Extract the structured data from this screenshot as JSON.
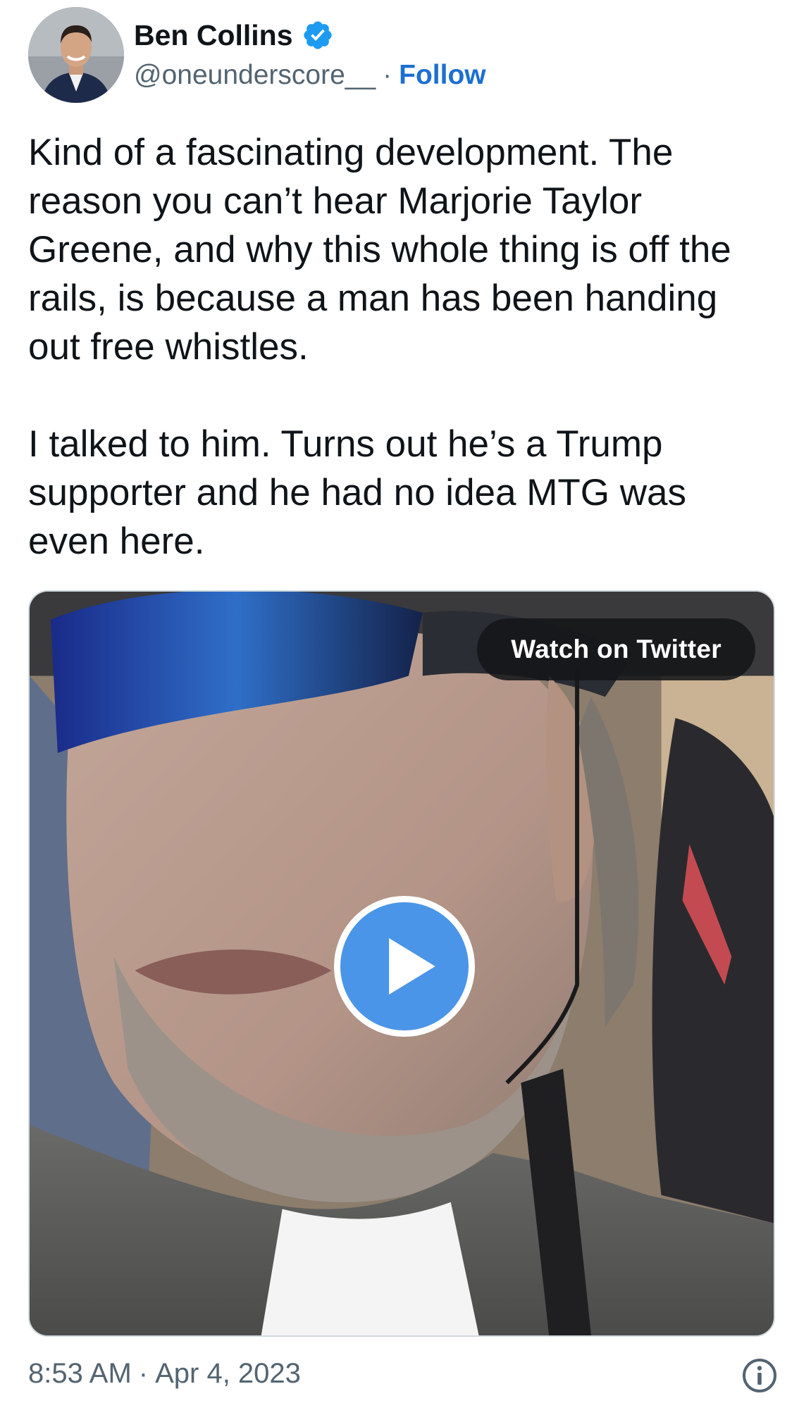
{
  "author": {
    "display_name": "Ben Collins",
    "handle": "@oneunderscore__",
    "separator": "·",
    "follow_label": "Follow",
    "verified_icon": "verified-badge-icon"
  },
  "tweet": {
    "paragraphs": [
      "Kind of a fascinating development. The reason you can’t hear Marjorie Taylor Greene, and why this whole thing is off the rails, is because a man has been handing out free whistles.",
      "I talked to him. Turns out he’s a Trump supporter and he had no idea MTG was even here."
    ]
  },
  "media": {
    "watch_label": "Watch on Twitter",
    "play_icon": "play-icon"
  },
  "footer": {
    "time": "8:53 AM",
    "separator": "·",
    "date": "Apr 4, 2023",
    "info_icon": "info-icon"
  },
  "colors": {
    "link_blue": "#1d6fd1",
    "verified_blue": "#1d9bf0",
    "play_blue": "#4a95e8",
    "secondary_text": "#536471"
  }
}
